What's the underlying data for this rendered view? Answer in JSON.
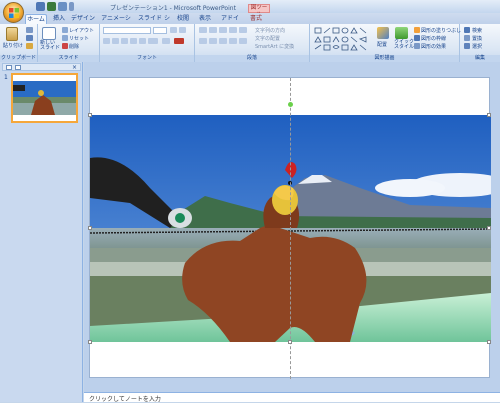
{
  "window": {
    "title": "プレゼンテーション1 - Microsoft PowerPoint",
    "context_tab": "図ツール"
  },
  "tabs": [
    {
      "label": "ホーム",
      "active": true
    },
    {
      "label": "挿入"
    },
    {
      "label": "デザイン"
    },
    {
      "label": "アニメーション"
    },
    {
      "label": "スライド ショー"
    },
    {
      "label": "校閲"
    },
    {
      "label": "表示"
    },
    {
      "label": "アドイン"
    },
    {
      "label": "書式"
    }
  ],
  "ribbon": {
    "groups": [
      {
        "label": "クリップボード"
      },
      {
        "label": "スライド"
      },
      {
        "label": "フォント"
      },
      {
        "label": "段落"
      },
      {
        "label": "図形描画"
      },
      {
        "label": "編集"
      }
    ],
    "clipboard": {
      "paste": "貼り付け"
    },
    "slides": {
      "new_slide": "新しい\nスライド",
      "layout": "レイアウト",
      "reset": "リセット",
      "delete": "削除"
    },
    "paragraph": {
      "text_direction": "文字列の方向",
      "align_text": "文字の配置",
      "smartart": "SmartArt に変換"
    },
    "drawing": {
      "arrange": "配置",
      "quick_styles": "クイック\nスタイル",
      "shape_fill": "図形の塗りつぶし",
      "shape_outline": "図形の枠線",
      "shape_effects": "図形の効果"
    },
    "editing": {
      "find": "検索",
      "replace": "置換",
      "select": "選択"
    }
  },
  "sidepanel": {
    "slide_number": "1"
  },
  "notes": {
    "placeholder": "クリックしてノートを入力"
  },
  "colors": {
    "accent": "#15428b",
    "selected": "#f5a73a"
  }
}
